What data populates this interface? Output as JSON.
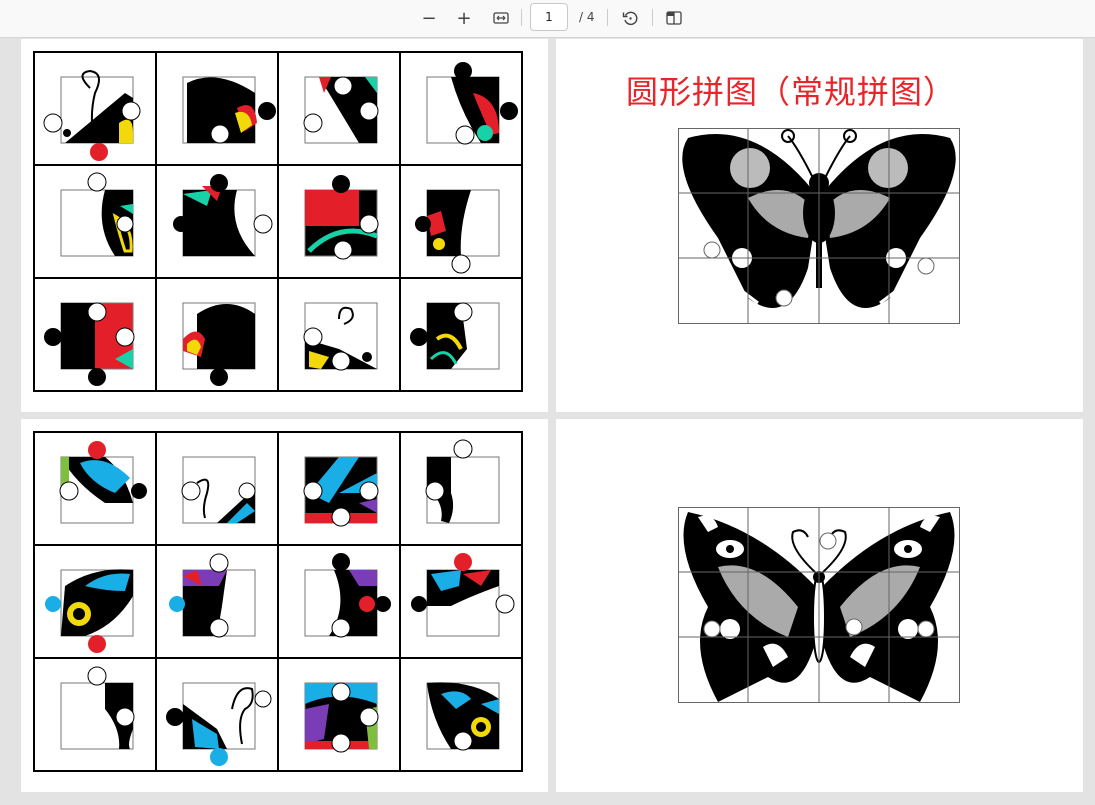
{
  "toolbar": {
    "zoom_out_label": "−",
    "zoom_in_label": "+",
    "fit_icon": "fit-width-icon",
    "page_current": "1",
    "page_total": "/ 4",
    "rotate_icon": "rotate-icon",
    "two_page_icon": "two-page-view-icon"
  },
  "pages": {
    "right_top_title": "圆形拼图（常规拼图）"
  },
  "colors": {
    "title_red": "#e8262a",
    "piece_red": "#e3202a",
    "piece_yellow": "#f3d90a",
    "piece_teal": "#19d1a6",
    "piece_blue": "#1aaee6",
    "piece_purple": "#7b3db5"
  }
}
